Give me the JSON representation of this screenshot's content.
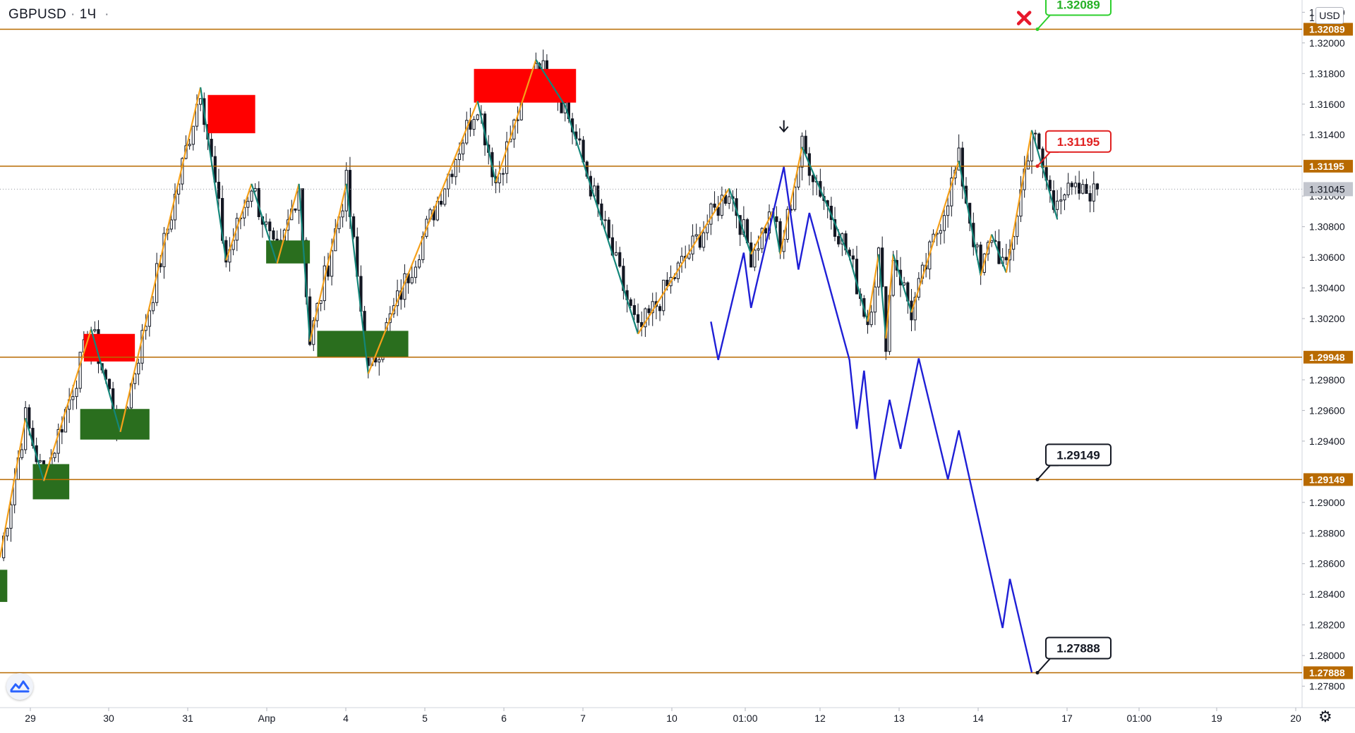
{
  "header": {
    "symbol": "GBPUSD",
    "interval": "1Ч",
    "dots": "·"
  },
  "currency_badge": "USD",
  "icons": {
    "logo": "tradingview-logo-icon",
    "settings": "gear-icon",
    "down_arrow": "down-arrow-icon",
    "cross": "red-cross-icon"
  },
  "colors": {
    "level_line": "#b86a00",
    "up_leg": "#f5a01a",
    "down_leg": "#14867a",
    "forecast": "#1f1fd6",
    "supply_zone": "#ff0000",
    "demand_zone": "#2a6e1e",
    "candle": "#131722",
    "green_callout": "#2ccf2c",
    "red_callout": "#e02020"
  },
  "chart_data": {
    "type": "candlestick",
    "ylim": [
      1.2766,
      1.3228
    ],
    "price_ticks": [
      "1.32200",
      "1.32000",
      "1.31800",
      "1.31600",
      "1.31400",
      "1.31000",
      "1.30800",
      "1.30600",
      "1.30400",
      "1.30200",
      "1.29800",
      "1.29600",
      "1.29400",
      "1.29000",
      "1.28800",
      "1.28600",
      "1.28400",
      "1.28200",
      "1.28000",
      "1.27800"
    ],
    "top_partial_tick": "1.",
    "time_ticks": [
      "29",
      "30",
      "31",
      "Апр",
      "4",
      "5",
      "6",
      "7",
      "10",
      "01:00",
      "12",
      "13",
      "14",
      "17",
      "01:00",
      "19",
      "20"
    ],
    "current_price": {
      "label": "1.31045",
      "value": 1.31045
    },
    "levels": [
      {
        "label": "1.32089",
        "value": 1.32089
      },
      {
        "label": "1.31195",
        "value": 1.31195
      },
      {
        "label": "1.29948",
        "value": 1.29948
      },
      {
        "label": "1.29149",
        "value": 1.29149
      },
      {
        "label": "1.27888",
        "value": 1.27888
      }
    ],
    "callouts": [
      {
        "label": "1.32089",
        "style": "green"
      },
      {
        "label": "1.31195",
        "style": "red"
      },
      {
        "label": "1.29149",
        "style": "black"
      },
      {
        "label": "1.27888",
        "style": "black"
      }
    ],
    "zigzag": [
      [
        0,
        1.2864
      ],
      [
        7,
        1.2955
      ],
      [
        12,
        1.2914
      ],
      [
        25,
        1.3013
      ],
      [
        33,
        1.2946
      ],
      [
        55,
        1.3171
      ],
      [
        62,
        1.3058
      ],
      [
        69,
        1.3108
      ],
      [
        76,
        1.3056
      ],
      [
        82,
        1.3108
      ],
      [
        85,
        1.3005
      ],
      [
        95,
        1.3108
      ],
      [
        101,
        1.2984
      ],
      [
        131,
        1.3162
      ],
      [
        136,
        1.3109
      ],
      [
        147,
        1.3189
      ],
      [
        155,
        1.3159
      ],
      [
        175,
        1.301
      ],
      [
        200,
        1.3105
      ],
      [
        206,
        1.3062
      ],
      [
        212,
        1.309
      ],
      [
        214,
        1.3062
      ],
      [
        220,
        1.3132
      ],
      [
        233,
        1.306
      ],
      [
        238,
        1.3018
      ],
      [
        241,
        1.3062
      ],
      [
        243,
        1.3007
      ],
      [
        245,
        1.3062
      ],
      [
        250,
        1.3024
      ],
      [
        263,
        1.3123
      ],
      [
        269,
        1.3048
      ],
      [
        272,
        1.3075
      ],
      [
        276,
        1.305
      ],
      [
        283,
        1.3143
      ],
      [
        290,
        1.3085
      ]
    ],
    "forecast": [
      [
        195,
        1.3018
      ],
      [
        197,
        1.2993
      ],
      [
        204,
        1.3063
      ],
      [
        206,
        1.3027
      ],
      [
        215,
        1.3119
      ],
      [
        219,
        1.3052
      ],
      [
        222,
        1.3089
      ],
      [
        233,
        1.2993
      ],
      [
        235,
        1.2948
      ],
      [
        237,
        1.2986
      ],
      [
        240,
        1.2915
      ],
      [
        244,
        1.2967
      ],
      [
        247,
        1.2935
      ],
      [
        252,
        1.2994
      ],
      [
        260,
        1.2915
      ],
      [
        263,
        1.2947
      ],
      [
        275,
        1.2818
      ],
      [
        277,
        1.285
      ],
      [
        283,
        1.2789
      ]
    ],
    "zones": [
      {
        "type": "supply",
        "x0": 23,
        "x1": 37,
        "y0": 1.301,
        "y1": 1.2992
      },
      {
        "type": "supply",
        "x0": 57,
        "x1": 70,
        "y0": 1.3166,
        "y1": 1.3141
      },
      {
        "type": "supply",
        "x0": 130,
        "x1": 158,
        "y0": 1.3183,
        "y1": 1.3161
      },
      {
        "type": "demand",
        "x0": -1,
        "x1": 2,
        "y0": 1.2856,
        "y1": 1.2835
      },
      {
        "type": "demand",
        "x0": 9,
        "x1": 19,
        "y0": 1.2925,
        "y1": 1.2902
      },
      {
        "type": "demand",
        "x0": 22,
        "x1": 41,
        "y0": 1.2961,
        "y1": 1.2941
      },
      {
        "type": "demand",
        "x0": 73,
        "x1": 85,
        "y0": 1.3071,
        "y1": 1.3056
      },
      {
        "type": "demand",
        "x0": 87,
        "x1": 112,
        "y0": 1.3012,
        "y1": 1.2995
      }
    ],
    "markers": {
      "down_arrow": {
        "x": 215,
        "y": 1.3132
      },
      "cross": {
        "x": 278,
        "y": 1.3207
      }
    },
    "last_bar": 301
  }
}
